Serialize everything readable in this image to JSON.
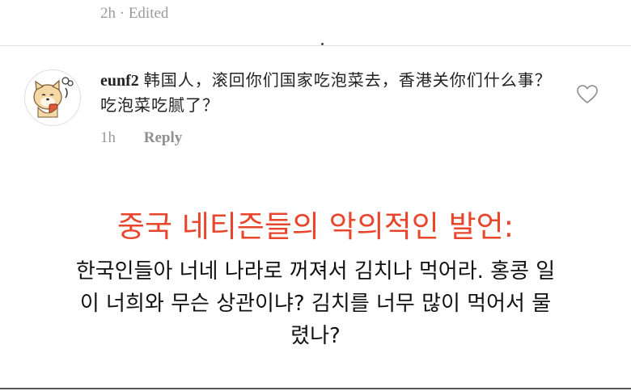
{
  "previous_comment": {
    "meta": "2h · Edited"
  },
  "comment": {
    "username": "eunf2",
    "text": "韩国人，滚回你们国家吃泡菜去，香港关你们什么事？吃泡菜吃腻了？",
    "time": "1h",
    "reply_label": "Reply",
    "avatar_icon": "shiba-dog-avatar-icon",
    "like_icon": "heart-outline-icon"
  },
  "annotation": {
    "title": "중국 네티즌들의 악의적인 발언:",
    "translation": "한국인들아 너네 나라로 꺼져서 김치나 먹어라. 홍콩 일이 너희와 무슨 상관이냐? 김치를 너무 많이 먹어서 물렸나?",
    "title_color": "#e8452c"
  }
}
